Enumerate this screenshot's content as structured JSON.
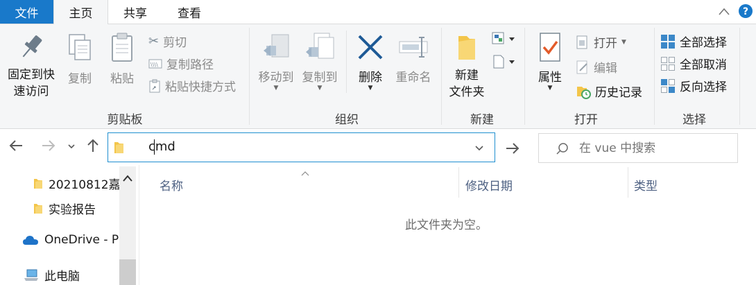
{
  "tabs": {
    "file": "文件",
    "home": "主页",
    "share": "共享",
    "view": "查看"
  },
  "ribbon": {
    "clipboard": {
      "pin": "固定到快\n速访问",
      "copy": "复制",
      "paste": "粘贴",
      "cut": "剪切",
      "copy_path": "复制路径",
      "paste_shortcut": "粘贴快捷方式",
      "label": "剪贴板"
    },
    "organize": {
      "move_to": "移动到",
      "copy_to": "复制到",
      "delete": "删除",
      "rename": "重命名",
      "label": "组织"
    },
    "new": {
      "new_folder": "新建\n文件夹",
      "label": "新建"
    },
    "open": {
      "properties": "属性",
      "open": "打开",
      "edit": "编辑",
      "history": "历史记录",
      "label": "打开"
    },
    "select": {
      "select_all": "全部选择",
      "select_none": "全部取消",
      "invert": "反向选择",
      "label": "选择"
    }
  },
  "address": {
    "path": "cmd"
  },
  "search": {
    "placeholder": "在 vue 中搜索"
  },
  "navpane": {
    "items": [
      {
        "label": "20210812嘉"
      },
      {
        "label": "实验报告"
      },
      {
        "label": "OneDrive - P"
      },
      {
        "label": "此电脑"
      }
    ]
  },
  "columns": {
    "name": "名称",
    "modified": "修改日期",
    "type": "类型"
  },
  "empty_message": "此文件夹为空。",
  "colors": {
    "accent": "#1979ca",
    "ribbon_bg": "#f5f6f7",
    "folder": "#f3c54a",
    "delete_x": "#1e5a96",
    "check": "#e35b2a"
  }
}
